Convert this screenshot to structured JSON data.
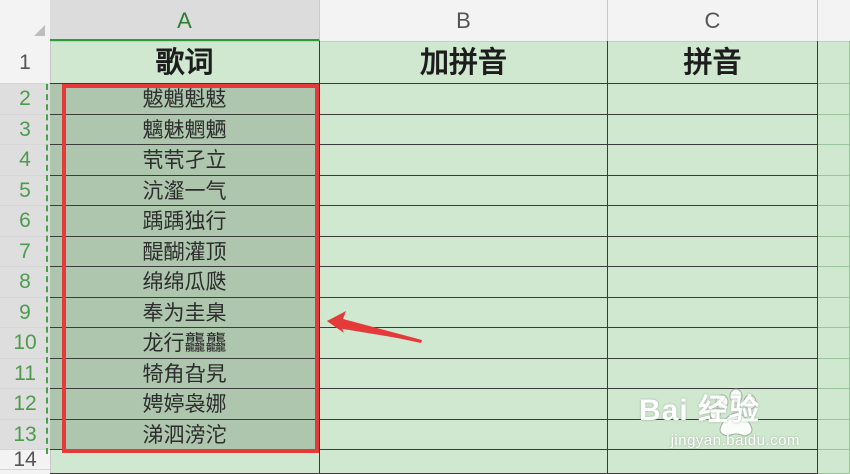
{
  "columns": [
    {
      "label": "A",
      "selected": true
    },
    {
      "label": "B",
      "selected": false
    },
    {
      "label": "C",
      "selected": false
    }
  ],
  "rows": [
    "1",
    "2",
    "3",
    "4",
    "5",
    "6",
    "7",
    "8",
    "9",
    "10",
    "11",
    "12",
    "13",
    "14"
  ],
  "header_row": {
    "a": "歌词",
    "b": "加拼音",
    "c": "拼音"
  },
  "lyrics": [
    "魃魈魁鬾",
    "魑魅魍魉",
    "茕茕孑立",
    "沆瀣一气",
    "踽踽独行",
    "醍醐灌顶",
    "绵绵瓜瓞",
    "奉为圭臬",
    "龙行龘龘",
    "犄角旮旯",
    "娉婷袅娜",
    "涕泗滂沱"
  ],
  "colors": {
    "selection_border": "#e53a3a",
    "cell_bg": "#cfe8cf",
    "selected_bg": "#adc6ad",
    "accent": "#2e9a3e"
  },
  "watermark": {
    "logo": "Bai 经验",
    "url": "jingyan.baidu.com"
  }
}
